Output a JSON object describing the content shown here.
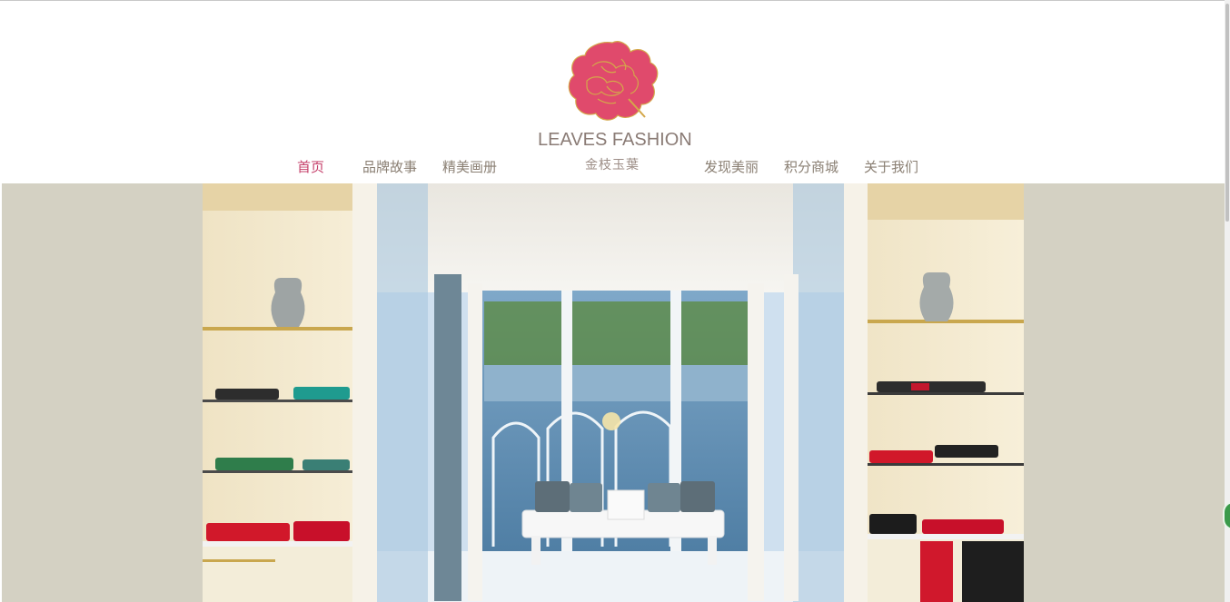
{
  "brand": {
    "name_en": "LEAVES FASHION",
    "name_zh": "金枝玉葉",
    "logo_color": "#e04a6c"
  },
  "nav": {
    "items": [
      {
        "label": "首页",
        "active": true
      },
      {
        "label": "品牌故事",
        "active": false
      },
      {
        "label": "精美画册",
        "active": false
      },
      {
        "label": "发现美丽",
        "active": false
      },
      {
        "label": "积分商城",
        "active": false
      },
      {
        "label": "关于我们",
        "active": false
      }
    ],
    "active_color": "#c53f6a",
    "text_color": "#8a7f73"
  },
  "banner": {
    "background_color": "#d4d1c3",
    "image": "boutique-interior-photo"
  }
}
